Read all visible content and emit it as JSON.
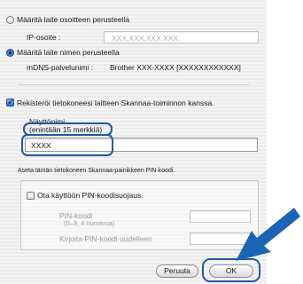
{
  "dialog": {
    "by_address_label": "Määritä laite osoitteen perusteella",
    "ip_label": "IP-osoite :",
    "ip_value": "XXX.XXX.XXX.XXX",
    "by_name_label": "Määritä laite nimen perusteella",
    "mdns_label": "mDNS-palvelunimi :",
    "mdns_value": "Brother XXX-XXXX   [XXXXXXXXXXXX]",
    "register_label": "Rekisteröi tietokoneesi laitteen Skannaa-toiminnon kanssa.",
    "display_name_label": "Näyttönimi",
    "display_name_hint": "(enintään 15 merkkiä)",
    "display_name_value": "XXXX",
    "pin_instruction": "Aseta tämän tietokoneen Skannaa-painikkeen PIN-koodi.",
    "pin_enable_label": "Ota käyttöön PIN-koodisuojaus.",
    "pin_code_label": "PIN-koodi",
    "pin_code_hint": "(0–9, 4 numeroa)",
    "pin_repeat_label": "Kirjoita PIN-koodi uudelleen",
    "cancel_label": "Peruuta",
    "ok_label": "OK"
  },
  "state": {
    "by_address_selected": false,
    "by_name_selected": true,
    "register_checked": true,
    "pin_enabled": false
  },
  "colors": {
    "highlight": "#1e5aa8",
    "arrow": "#1a65b5"
  }
}
